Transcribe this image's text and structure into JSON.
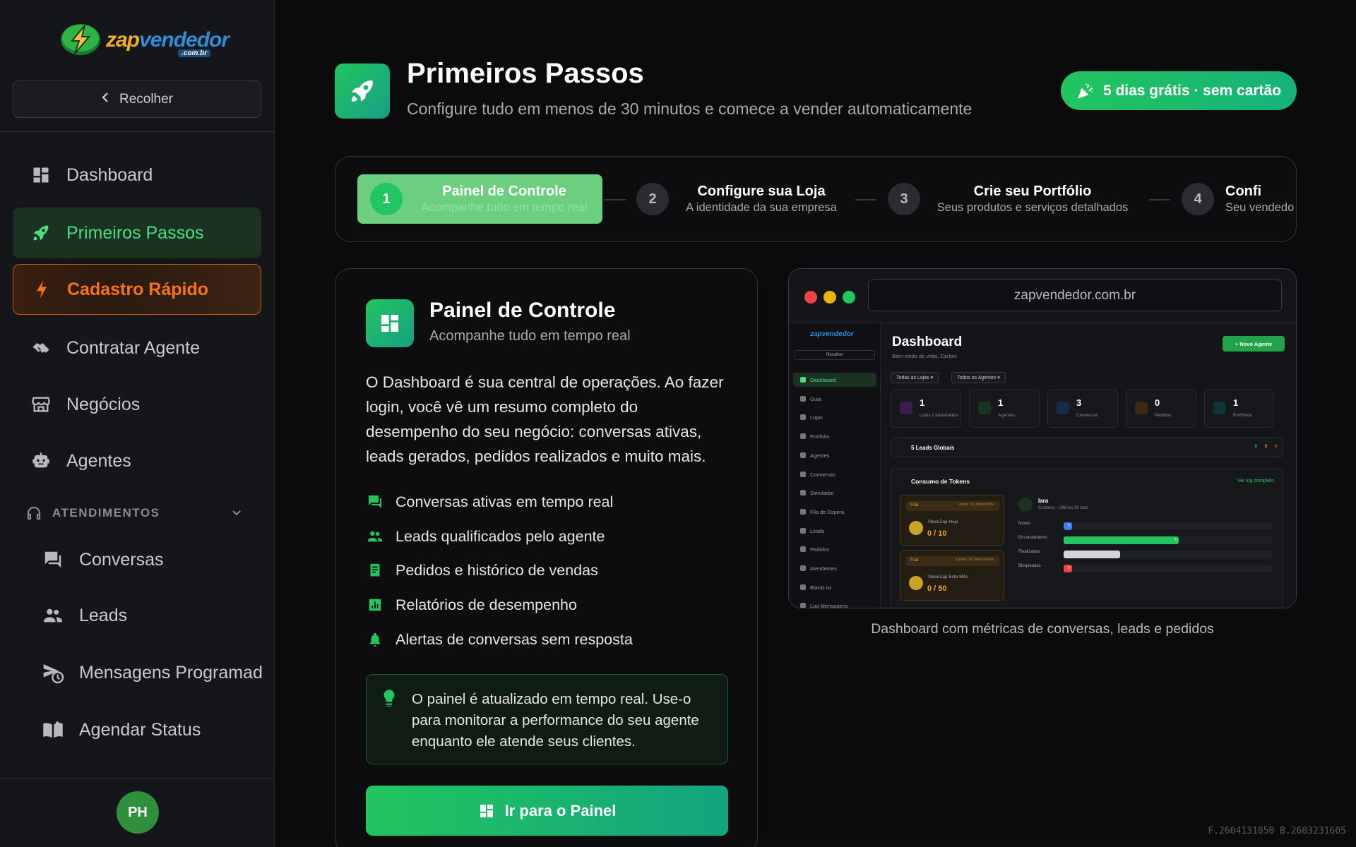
{
  "brand": {
    "name_z": "zap",
    "name_rest": "vendedor",
    "tld": ".com.br"
  },
  "sidebar": {
    "collapse_label": "Recolher",
    "items": [
      {
        "label": "Dashboard",
        "icon": "dashboard-icon"
      },
      {
        "label": "Primeiros Passos",
        "icon": "rocket-icon",
        "active": true
      },
      {
        "label": "Cadastro Rápido",
        "icon": "bolt-icon"
      },
      {
        "label": "Contratar Agente",
        "icon": "handshake-icon"
      },
      {
        "label": "Negócios",
        "icon": "store-icon"
      },
      {
        "label": "Agentes",
        "icon": "robot-icon"
      }
    ],
    "section": {
      "label": "ATENDIMENTOS",
      "icon": "headset-icon"
    },
    "sub_items": [
      {
        "label": "Conversas",
        "icon": "chat-icon"
      },
      {
        "label": "Leads",
        "icon": "people-icon"
      },
      {
        "label": "Mensagens Programad",
        "icon": "scheduled-send-icon"
      },
      {
        "label": "Agendar Status",
        "icon": "book-icon"
      }
    ],
    "avatar_initials": "PH"
  },
  "header": {
    "title": "Primeiros Passos",
    "subtitle": "Configure tudo em menos de 30 minutos e comece a vender automaticamente",
    "trial_badge": "5 dias grátis · sem cartão"
  },
  "steps": [
    {
      "num": "1",
      "title": "Painel de Controle",
      "desc": "Acompanhe tudo em tempo real",
      "active": true
    },
    {
      "num": "2",
      "title": "Configure sua Loja",
      "desc": "A identidade da sua empresa"
    },
    {
      "num": "3",
      "title": "Crie seu Portfólio",
      "desc": "Seus produtos e serviços detalhados"
    },
    {
      "num": "4",
      "title": "Confi",
      "desc": "Seu vendedo"
    }
  ],
  "card": {
    "title": "Painel de Controle",
    "subtitle": "Acompanhe tudo em tempo real",
    "description": "O Dashboard é sua central de operações. Ao fazer login, você vê um resumo completo do desempenho do seu negócio: conversas ativas, leads gerados, pedidos realizados e muito mais.",
    "features": [
      {
        "label": "Conversas ativas em tempo real",
        "icon": "chat-icon"
      },
      {
        "label": "Leads qualificados pelo agente",
        "icon": "people-icon"
      },
      {
        "label": "Pedidos e histórico de vendas",
        "icon": "receipt-icon"
      },
      {
        "label": "Relatórios de desempenho",
        "icon": "report-icon"
      },
      {
        "label": "Alertas de conversas sem resposta",
        "icon": "bell-icon"
      }
    ],
    "tip": "O painel é atualizado em tempo real. Use-o para monitorar a performance do seu agente enquanto ele atende seus clientes.",
    "cta": "Ir para o Painel"
  },
  "preview": {
    "url": "zapvendedor.com.br",
    "caption": "Dashboard com métricas de conversas, leads e pedidos",
    "app": {
      "logo": "zapvendedor",
      "collapse": "Recolher",
      "nav": [
        "Dashboard",
        "Guia",
        "Lojas",
        "Portfolio",
        "Agentes",
        "Conversas",
        "Simulador",
        "Fila de Espera",
        "Leads",
        "Pedidos",
        "Atendentes",
        "BlackList",
        "Log Mensagens"
      ],
      "title": "Dashboard",
      "welcome": "Bem-vindo de volta, Carlos!",
      "new_agent": "+ Novo Agente",
      "filters": [
        "Todas as Lojas",
        "Todos os Agentes"
      ],
      "stats": [
        {
          "value": "1",
          "label": "Lojas Cadastradas",
          "color": "#a855f7"
        },
        {
          "value": "1",
          "label": "Agentes",
          "color": "#22c55e"
        },
        {
          "value": "3",
          "label": "Conversas",
          "color": "#3b82f6"
        },
        {
          "value": "0",
          "label": "Pedidos",
          "color": "#f59e0b"
        },
        {
          "value": "1",
          "label": "Portfólios",
          "color": "#06b6d4"
        }
      ],
      "leads_label": "5 Leads Globais",
      "leads_counts": [
        "0",
        "5",
        "0"
      ],
      "tokens_title": "Consumo de Tokens",
      "tokens_link": "Ver log completo",
      "token_cards": [
        {
          "badge": "Trial",
          "limit": "Limite: 10 tokens/dia",
          "name": "TokenZap Hoje",
          "value": "0 / 10"
        },
        {
          "badge": "Trial",
          "limit": "Limite: 50 tokens/mês",
          "name": "TokenZap Este Mês",
          "value": "0 / 50"
        }
      ],
      "agent_name": "Iara",
      "agent_sub": "Contatos - Últimos 30 dias",
      "agent_rows": [
        {
          "label": "Novos",
          "value": "0",
          "fill": 0.04,
          "color": "#3b82f6"
        },
        {
          "label": "Em andamento",
          "value": "5",
          "fill": 0.55,
          "color": "#22c55e"
        },
        {
          "label": "Finalizadas",
          "value": "",
          "fill": 0.27,
          "color": "#d4d4d8"
        },
        {
          "label": "Bloqueadas",
          "value": "0",
          "fill": 0.04,
          "color": "#ef4444"
        }
      ]
    }
  },
  "build_id": "F.2604131050 B.2603231605"
}
